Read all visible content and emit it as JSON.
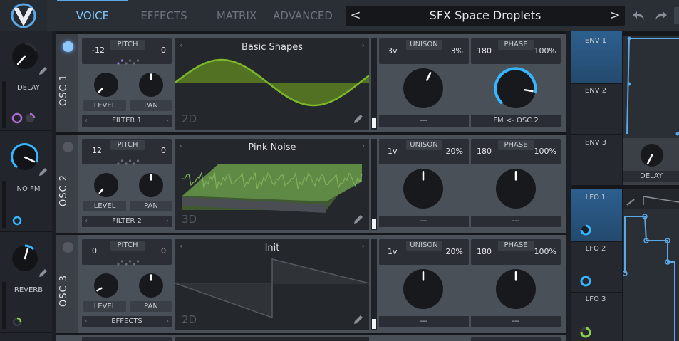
{
  "tabs": [
    {
      "label": "VOICE",
      "active": true
    },
    {
      "label": "EFFECTS"
    },
    {
      "label": "MATRIX"
    },
    {
      "label": "ADVANCED"
    }
  ],
  "preset": {
    "name": "SFX Space Droplets",
    "prev": "<",
    "next": ">"
  },
  "macros": [
    {
      "label": "DELAY"
    },
    {
      "label": "NO FM"
    },
    {
      "label": "REVERB"
    }
  ],
  "oscillators": [
    {
      "name": "OSC 1",
      "pitch_label": "PITCH",
      "transpose": "-12",
      "tune": "0",
      "level": "LEVEL",
      "pan": "PAN",
      "dest": "FILTER 1",
      "wave": "Basic Shapes",
      "dim": "2D",
      "unison": "UNISON",
      "voices": "3v",
      "detune": "3%",
      "phase_label": "PHASE",
      "phase": "180",
      "phase_pct": "100%",
      "unison_sel": "---",
      "phase_sel": "FM <- OSC 2"
    },
    {
      "name": "OSC 2",
      "pitch_label": "PITCH",
      "transpose": "12",
      "tune": "0",
      "level": "LEVEL",
      "pan": "PAN",
      "dest": "FILTER 2",
      "wave": "Pink Noise",
      "dim": "3D",
      "unison": "UNISON",
      "voices": "1v",
      "detune": "20%",
      "phase_label": "PHASE",
      "phase": "180",
      "phase_pct": "100%",
      "unison_sel": "---",
      "phase_sel": "---"
    },
    {
      "name": "OSC 3",
      "pitch_label": "PITCH",
      "transpose": "0",
      "tune": "0",
      "level": "LEVEL",
      "pan": "PAN",
      "dest": "EFFECTS",
      "wave": "Init",
      "dim": "2D",
      "unison": "UNISON",
      "voices": "1v",
      "detune": "20%",
      "phase_label": "PHASE",
      "phase": "180",
      "phase_pct": "100%",
      "unison_sel": "---",
      "phase_sel": "---"
    }
  ],
  "envs": [
    {
      "label": "ENV 1"
    },
    {
      "label": "ENV 2"
    },
    {
      "label": "ENV 3"
    }
  ],
  "env_knob": "DELAY",
  "lfos": [
    {
      "label": "LFO 1"
    },
    {
      "label": "LFO 2"
    },
    {
      "label": "LFO 3"
    }
  ],
  "colors": {
    "accent": "#5aa8e8",
    "wave": "#7db82a",
    "noise": "#5f8a45",
    "knob_arc": "#35b6ff"
  }
}
